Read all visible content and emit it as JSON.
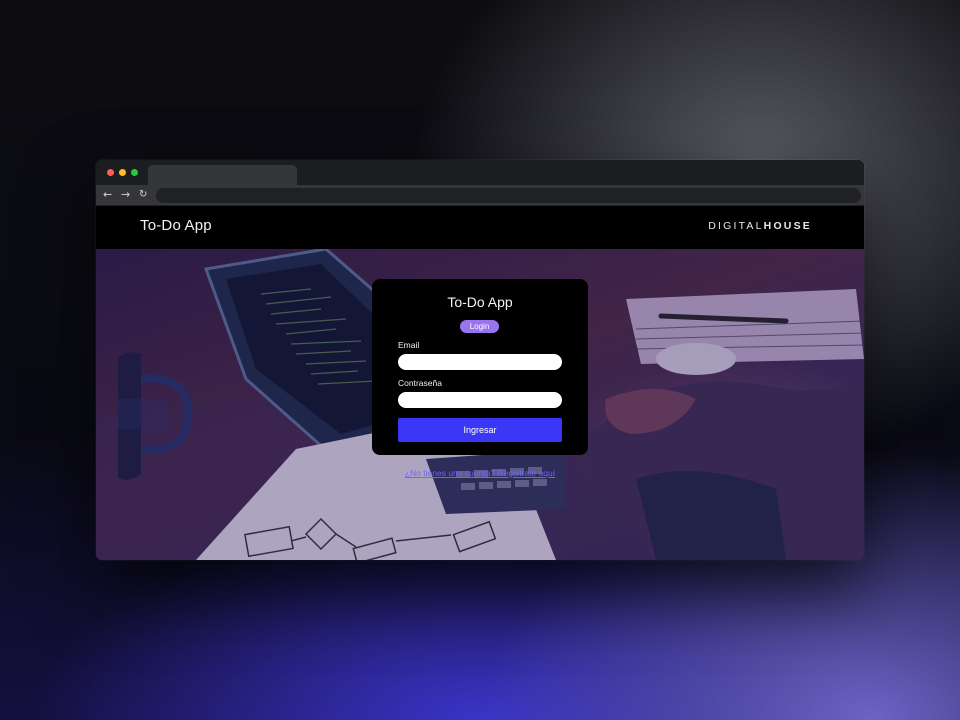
{
  "browser": {
    "controls": {
      "back_icon": "arrow-left-icon",
      "forward_icon": "arrow-right-icon",
      "reload_icon": "reload-icon"
    }
  },
  "header": {
    "app_title": "To-Do App",
    "logo_light": "DIGITAL",
    "logo_bold": "HOUSE"
  },
  "login": {
    "title": "To-Do App",
    "tab_label": "Login",
    "email_label": "Email",
    "email_value": "",
    "password_label": "Contraseña",
    "password_value": "",
    "submit_label": "Ingresar",
    "register_link": "¿No tienes una cuenta? Registrate aquí"
  },
  "colors": {
    "accent_button": "#3a38f6",
    "pill": "#9a74ec",
    "link": "#6f64ff"
  }
}
